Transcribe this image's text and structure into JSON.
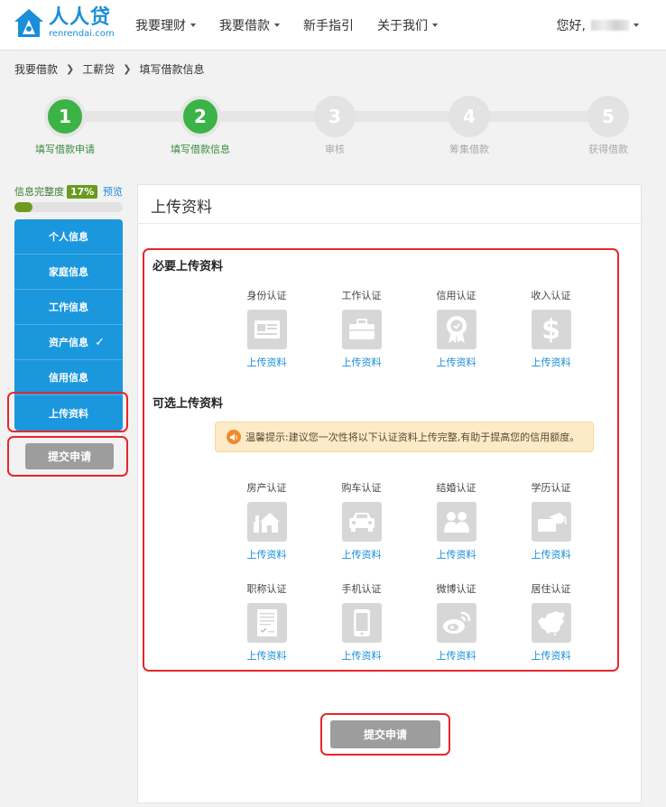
{
  "header": {
    "logo_cn": "人人贷",
    "logo_en": "renrendai.com",
    "nav": [
      {
        "label": "我要理财",
        "dropdown": true
      },
      {
        "label": "我要借款",
        "dropdown": true
      },
      {
        "label": "新手指引",
        "dropdown": false
      },
      {
        "label": "关于我们",
        "dropdown": true
      }
    ],
    "greeting": "您好,"
  },
  "breadcrumb": [
    "我要借款",
    "工薪贷",
    "填写借款信息"
  ],
  "steps": [
    {
      "num": "1",
      "label": "填写借款申请",
      "state": "done"
    },
    {
      "num": "2",
      "label": "填写借款信息",
      "state": "done"
    },
    {
      "num": "3",
      "label": "审核",
      "state": "todo"
    },
    {
      "num": "4",
      "label": "筹集借款",
      "state": "todo"
    },
    {
      "num": "5",
      "label": "获得借款",
      "state": "todo"
    }
  ],
  "sidebar": {
    "completeness_label": "信息完整度",
    "completeness_pct": "17%",
    "completeness_value": 0.17,
    "preview_label": "预览",
    "items": [
      {
        "label": "个人信息",
        "checked": false
      },
      {
        "label": "家庭信息",
        "checked": false
      },
      {
        "label": "工作信息",
        "checked": false
      },
      {
        "label": "资产信息",
        "checked": true
      },
      {
        "label": "信用信息",
        "checked": false
      },
      {
        "label": "上传资料",
        "checked": false
      }
    ],
    "submit_label": "提交申请"
  },
  "main": {
    "title": "上传资料",
    "required_title": "必要上传资料",
    "required": [
      {
        "label": "身份认证",
        "icon": "id-card-icon",
        "link": "上传资料"
      },
      {
        "label": "工作认证",
        "icon": "briefcase-icon",
        "link": "上传资料"
      },
      {
        "label": "信用认证",
        "icon": "award-ribbon-icon",
        "link": "上传资料"
      },
      {
        "label": "收入认证",
        "icon": "dollar-icon",
        "link": "上传资料"
      }
    ],
    "optional_title": "可选上传资料",
    "tip": "温馨提示:建议您一次性将以下认证资料上传完整,有助于提高您的信用额度。",
    "optional_row1": [
      {
        "label": "房产认证",
        "icon": "house-icon",
        "link": "上传资料"
      },
      {
        "label": "购车认证",
        "icon": "car-icon",
        "link": "上传资料"
      },
      {
        "label": "结婚认证",
        "icon": "couple-icon",
        "link": "上传资料"
      },
      {
        "label": "学历认证",
        "icon": "graduation-cap-icon",
        "link": "上传资料"
      }
    ],
    "optional_row2": [
      {
        "label": "职称认证",
        "icon": "certificate-doc-icon",
        "link": "上传资料"
      },
      {
        "label": "手机认证",
        "icon": "phone-icon",
        "link": "上传资料"
      },
      {
        "label": "微博认证",
        "icon": "weibo-icon",
        "link": "上传资料"
      },
      {
        "label": "居住认证",
        "icon": "china-map-icon",
        "link": "上传资料"
      }
    ],
    "submit_label": "提交申请"
  },
  "colors": {
    "brand_blue": "#1b97dd",
    "step_green": "#3cb346",
    "highlight_red": "#e8262b",
    "button_gray": "#9d9d9d"
  }
}
